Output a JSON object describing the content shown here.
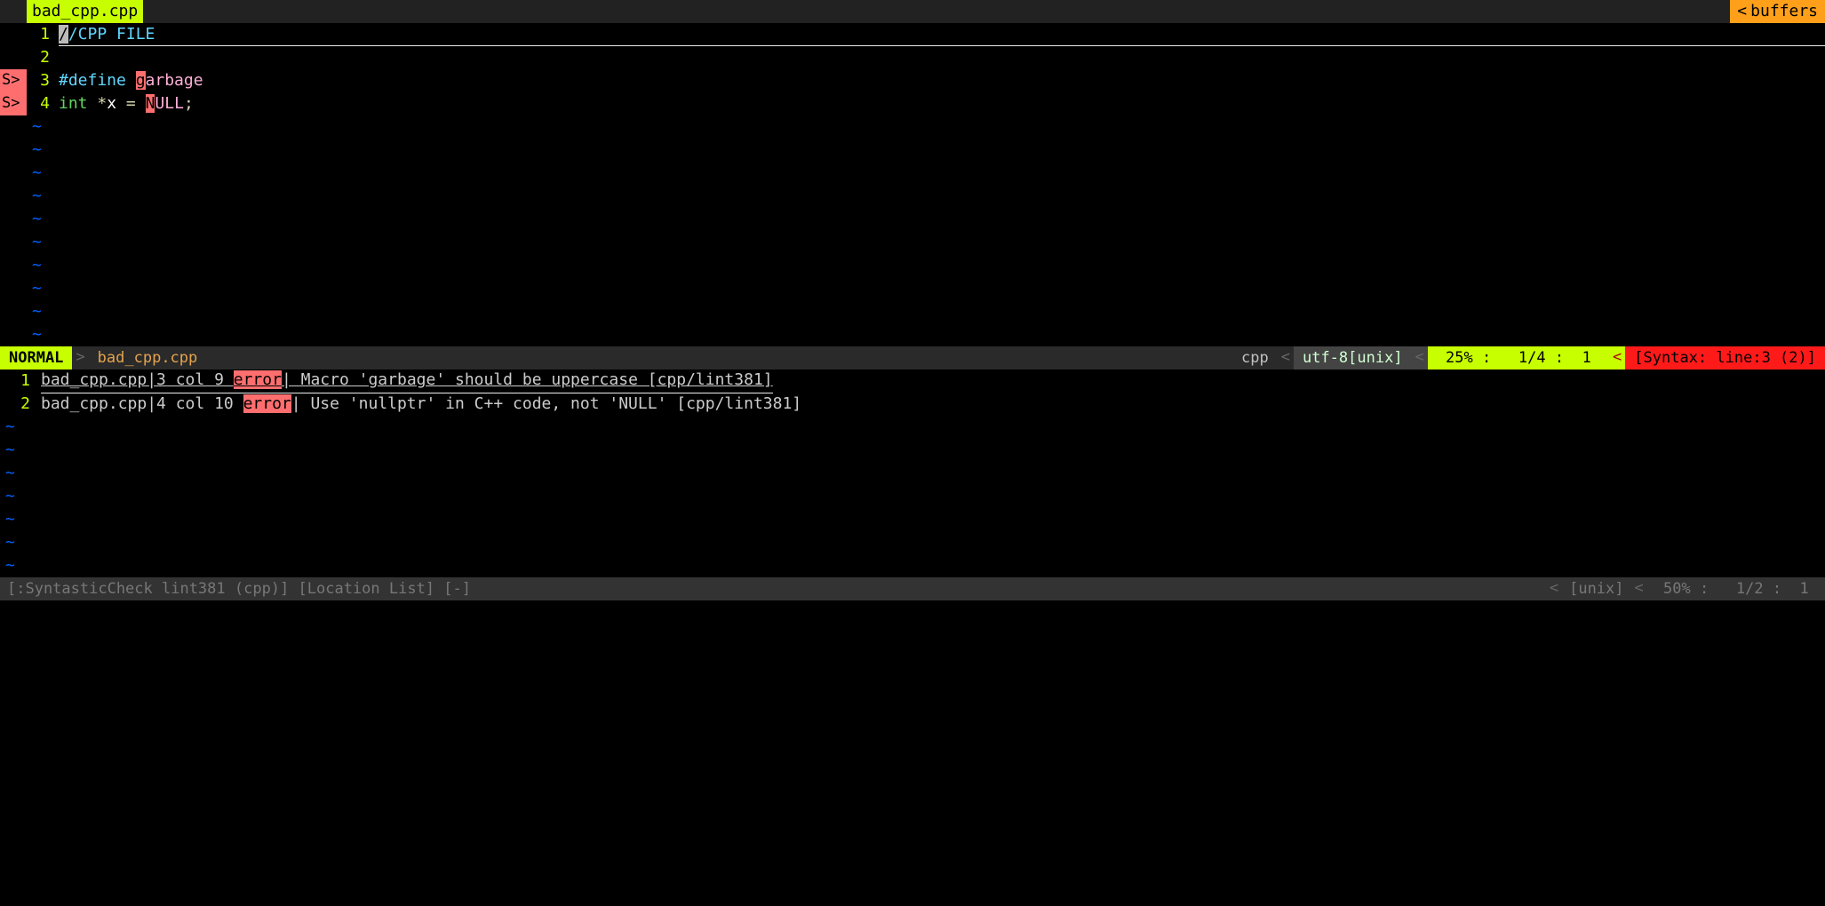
{
  "tabbar": {
    "filename": "bad_cpp.cpp",
    "buffers_label": "buffers"
  },
  "signs": {
    "err": "S>"
  },
  "code": {
    "lines": [
      {
        "num": "1",
        "sign": "",
        "current": true,
        "tokens": [
          {
            "t": "cursor",
            "v": "/"
          },
          {
            "t": "comment",
            "v": "/CPP FILE"
          }
        ]
      },
      {
        "num": "2",
        "sign": "",
        "tokens": []
      },
      {
        "num": "3",
        "sign": "err",
        "tokens": [
          {
            "t": "preproc",
            "v": "#define "
          },
          {
            "t": "errchar",
            "v": "g"
          },
          {
            "t": "macro",
            "v": "arbage"
          }
        ]
      },
      {
        "num": "4",
        "sign": "err",
        "tokens": [
          {
            "t": "type",
            "v": "int "
          },
          {
            "t": "op",
            "v": "*"
          },
          {
            "t": "ident",
            "v": "x "
          },
          {
            "t": "op",
            "v": "= "
          },
          {
            "t": "errchar",
            "v": "N"
          },
          {
            "t": "macro",
            "v": "ULL"
          },
          {
            "t": "op",
            "v": ";"
          }
        ]
      }
    ],
    "tilde_count": 10
  },
  "status1": {
    "mode": "NORMAL",
    "file": "bad_cpp.cpp",
    "filetype": "cpp",
    "encoding": "utf-8[unix]",
    "position": " 25% :   1/4 :  1 ",
    "syntax": "[Syntax: line:3 (2)]"
  },
  "loclist": {
    "items": [
      {
        "num": "1",
        "current": true,
        "prefix": "bad_cpp.cpp|3 col 9 ",
        "err": "error",
        "suffix": "| Macro 'garbage' should be uppercase [cpp/lint381]"
      },
      {
        "num": "2",
        "current": false,
        "prefix": "bad_cpp.cpp|4 col 10 ",
        "err": "error",
        "suffix": "| Use 'nullptr' in C++ code, not 'NULL' [cpp/lint381]"
      }
    ],
    "tilde_count": 7
  },
  "status2": {
    "title": "[:SyntasticCheck lint381 (cpp)] [Location List] [-]",
    "encoding": "[unix]",
    "position": " 50% :   1/2 :  1 "
  }
}
